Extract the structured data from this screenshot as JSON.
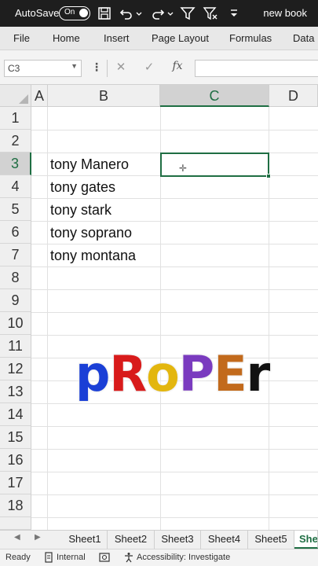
{
  "titlebar": {
    "autosave_label": "AutoSave",
    "autosave_state": "On",
    "book_name": "new book",
    "icons": [
      "save-icon",
      "undo-icon",
      "redo-icon",
      "filter-icon",
      "clear-filter-icon",
      "customize-icon"
    ]
  },
  "ribbon": {
    "tabs": [
      "File",
      "Home",
      "Insert",
      "Page Layout",
      "Formulas",
      "Data"
    ]
  },
  "formula_bar": {
    "name_box": "C3",
    "formula": "",
    "fx_label": "fx"
  },
  "grid": {
    "columns": [
      "A",
      "B",
      "C",
      "D"
    ],
    "selected_column": "C",
    "rows": [
      "1",
      "2",
      "3",
      "4",
      "5",
      "6",
      "7",
      "8",
      "9",
      "10",
      "11",
      "12",
      "13",
      "14",
      "15",
      "16",
      "17",
      "18"
    ],
    "selected_row": "3",
    "cells": {
      "B3": "tony Manero",
      "B4": "tony gates",
      "B5": "tony stark",
      "B6": "tony soprano",
      "B7": "tony montana"
    }
  },
  "overlay": {
    "letters": [
      "p",
      "R",
      "o",
      "P",
      "E",
      "r"
    ],
    "colors": [
      "#1a3fd6",
      "#d81b1b",
      "#e3b60e",
      "#7a3bbf",
      "#c26a1c",
      "#111111"
    ]
  },
  "sheets": {
    "tabs": [
      "Sheet1",
      "Sheet2",
      "Sheet3",
      "Sheet4",
      "Sheet5",
      "She"
    ],
    "active_index": 5
  },
  "status": {
    "ready": "Ready",
    "internal": "Internal",
    "accessibility": "Accessibility: Investigate"
  },
  "colors": {
    "excel_green": "#1f6e43",
    "titlebar": "#1e1e1e"
  }
}
